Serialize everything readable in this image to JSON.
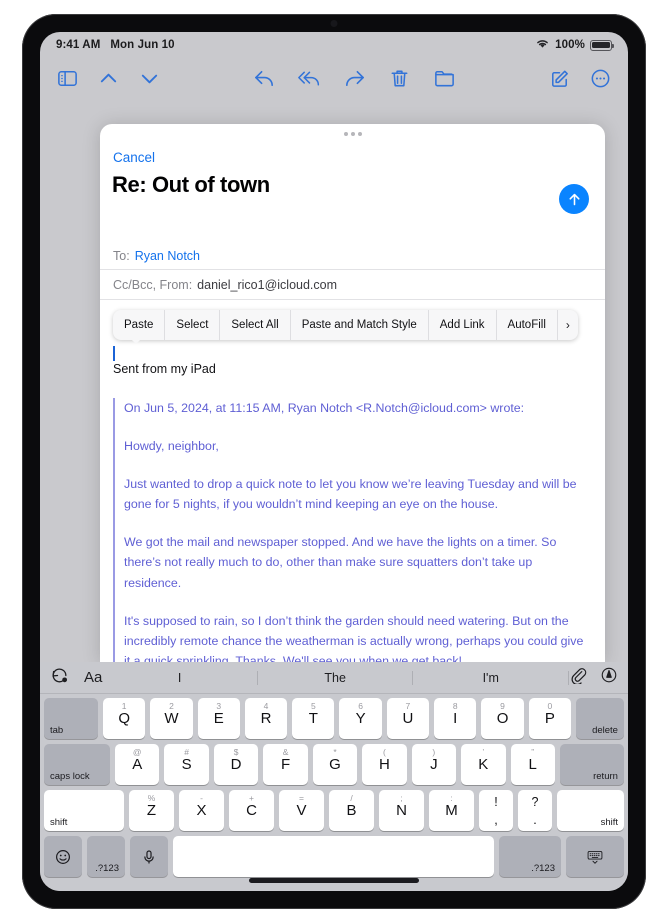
{
  "status_bar": {
    "time": "9:41 AM",
    "date": "Mon Jun 10",
    "battery_percent": "100%",
    "wifi_icon": "wifi-icon",
    "battery_icon": "battery-icon"
  },
  "mail_toolbar": {
    "sidebar_icon": "sidebar-toggle-icon",
    "up_icon": "chevron-up-icon",
    "down_icon": "chevron-down-icon",
    "reply_icon": "reply-icon",
    "reply_all_icon": "reply-all-icon",
    "forward_icon": "forward-icon",
    "trash_icon": "trash-icon",
    "folder_icon": "folder-icon",
    "compose_icon": "compose-icon",
    "more_icon": "more-ellipsis-icon"
  },
  "compose": {
    "grabber": "drag-handle",
    "cancel_label": "Cancel",
    "subject": "Re: Out of town",
    "send_icon": "send-arrow-up-icon",
    "to_label": "To:",
    "to_value": "Ryan Notch",
    "ccbcc_label": "Cc/Bcc, From:",
    "from_value": "daniel_rico1@icloud.com"
  },
  "edit_menu": {
    "items": [
      {
        "label": "Paste"
      },
      {
        "label": "Select"
      },
      {
        "label": "Select All"
      },
      {
        "label": "Paste and Match Style"
      },
      {
        "label": "Add Link"
      },
      {
        "label": "AutoFill"
      }
    ],
    "more_chevron": "›"
  },
  "body": {
    "signature": "Sent from my iPad",
    "quoted_paragraphs": [
      "On Jun 5, 2024, at 11:15 AM, Ryan Notch <R.Notch@icloud.com> wrote:",
      "Howdy, neighbor,",
      "Just wanted to drop a quick note to let you know we’re leaving Tuesday and will be gone for 5 nights, if you wouldn’t mind keeping an eye on the house.",
      "We got the mail and newspaper stopped. And we have the lights on a timer. So there’s not really much to do, other than make sure squatters don’t take up residence.",
      "It's supposed to rain, so I don’t think the garden should need watering. But on the incredibly remote chance the weatherman is actually wrong, perhaps you could give it a quick sprinkling. Thanks. We'll see you when we get back!"
    ]
  },
  "keyboard": {
    "predictive": {
      "undo_icon": "undo-redo-icon",
      "format_label": "Aa",
      "suggestions": [
        "I",
        "The",
        "I'm"
      ],
      "attach_icon": "paperclip-icon",
      "markup_icon": "markup-pen-icon"
    },
    "rows": [
      {
        "keys": [
          {
            "label": "tab",
            "style": "grey",
            "size": "tab",
            "align": "left"
          },
          {
            "label": "Q",
            "alt": "1"
          },
          {
            "label": "W",
            "alt": "2"
          },
          {
            "label": "E",
            "alt": "3"
          },
          {
            "label": "R",
            "alt": "4"
          },
          {
            "label": "T",
            "alt": "5"
          },
          {
            "label": "Y",
            "alt": "6"
          },
          {
            "label": "U",
            "alt": "7"
          },
          {
            "label": "I",
            "alt": "8"
          },
          {
            "label": "O",
            "alt": "9"
          },
          {
            "label": "P",
            "alt": "0"
          },
          {
            "label": "delete",
            "style": "grey",
            "size": "delete",
            "align": "right"
          }
        ]
      },
      {
        "keys": [
          {
            "label": "caps lock",
            "style": "grey",
            "size": "capslock",
            "align": "left"
          },
          {
            "label": "A",
            "alt": "@"
          },
          {
            "label": "S",
            "alt": "#"
          },
          {
            "label": "D",
            "alt": "$"
          },
          {
            "label": "F",
            "alt": "&"
          },
          {
            "label": "G",
            "alt": "*"
          },
          {
            "label": "H",
            "alt": "("
          },
          {
            "label": "J",
            "alt": ")"
          },
          {
            "label": "K",
            "alt": "’"
          },
          {
            "label": "L",
            "alt": "”"
          },
          {
            "label": "return",
            "style": "grey",
            "size": "return",
            "align": "right"
          }
        ]
      },
      {
        "keys": [
          {
            "label": "shift",
            "size": "shift-l",
            "align": "left"
          },
          {
            "label": "Z",
            "alt": "%"
          },
          {
            "label": "X",
            "alt": "-"
          },
          {
            "label": "C",
            "alt": "+"
          },
          {
            "label": "V",
            "alt": "="
          },
          {
            "label": "B",
            "alt": "/"
          },
          {
            "label": "N",
            "alt": ";"
          },
          {
            "label": "M",
            "alt": ":"
          },
          {
            "dual_top": "!",
            "dual_bottom": ",",
            "size": "punct"
          },
          {
            "dual_top": "?",
            "dual_bottom": ".",
            "size": "punct"
          },
          {
            "label": "shift",
            "size": "shift-r",
            "align": "right"
          }
        ]
      },
      {
        "keys": [
          {
            "icon": "emoji-icon",
            "style": "grey",
            "size": "bsmall"
          },
          {
            "label": ".?123",
            "style": "grey",
            "size": "bsmall",
            "align": "center-small"
          },
          {
            "icon": "microphone-icon",
            "style": "grey",
            "size": "bsmall"
          },
          {
            "label": "",
            "size": "space"
          },
          {
            "label": ".?123",
            "style": "grey",
            "size": "num-r",
            "align": "right"
          },
          {
            "icon": "hide-keyboard-icon",
            "style": "grey",
            "size": "kbdown"
          }
        ]
      }
    ]
  },
  "colors": {
    "accent_blue": "#0a84ff",
    "toolbar_blue": "#3273d8",
    "quote_purple": "#5f5fd4",
    "keyboard_bg": "#c8c9ce"
  }
}
